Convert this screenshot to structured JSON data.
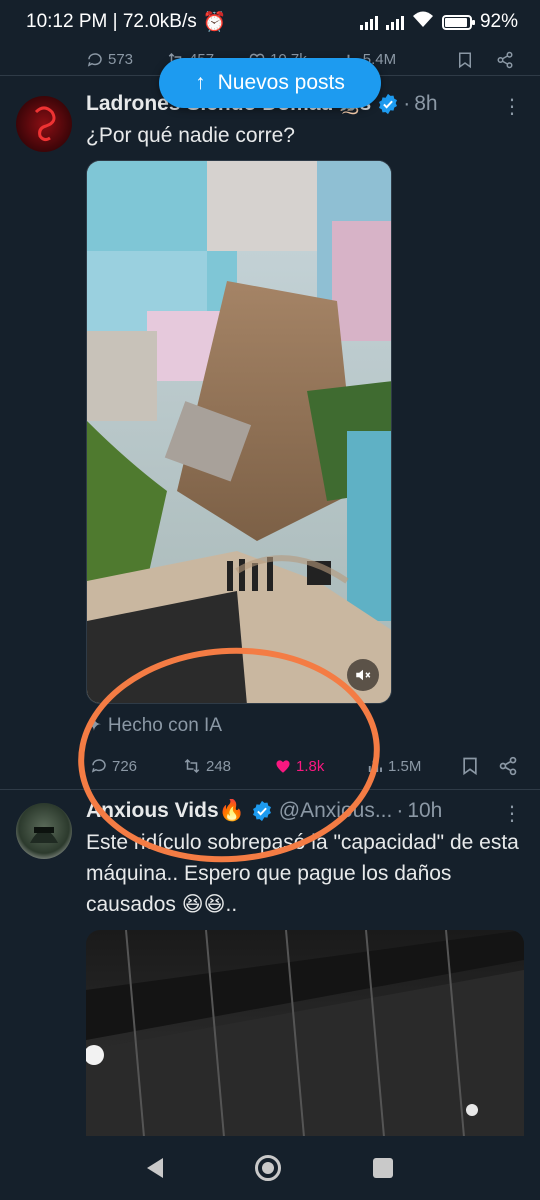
{
  "status_bar": {
    "time_speed": "10:12 PM | 72.0kB/s",
    "battery": "92%",
    "battery_level": 0.92
  },
  "previous_post_actions": {
    "replies": "573",
    "reposts": "457",
    "likes": "10.7k",
    "views": "5.4M"
  },
  "new_posts_pill": {
    "label": "Nuevos posts"
  },
  "posts": [
    {
      "author": "Ladrones Siendo Domad🐀s",
      "verified": true,
      "time": "8h",
      "text": "¿Por qué nadie corre?",
      "ai_label": "Hecho con IA",
      "replies": "726",
      "reposts": "248",
      "likes": "1.8k",
      "views": "1.5M",
      "liked": true
    },
    {
      "author": "Anxious Vids🔥",
      "handle": "@Anxious...",
      "verified": true,
      "time": "10h",
      "text": "Este ridículo sobrepasó la \"capacidad\" de esta máquina.. Espero que pague los daños causados 😆😆.."
    }
  ],
  "colors": {
    "background": "#15202b",
    "accent": "#1d9bf0",
    "like": "#f91880",
    "annotation": "#f47c44"
  }
}
